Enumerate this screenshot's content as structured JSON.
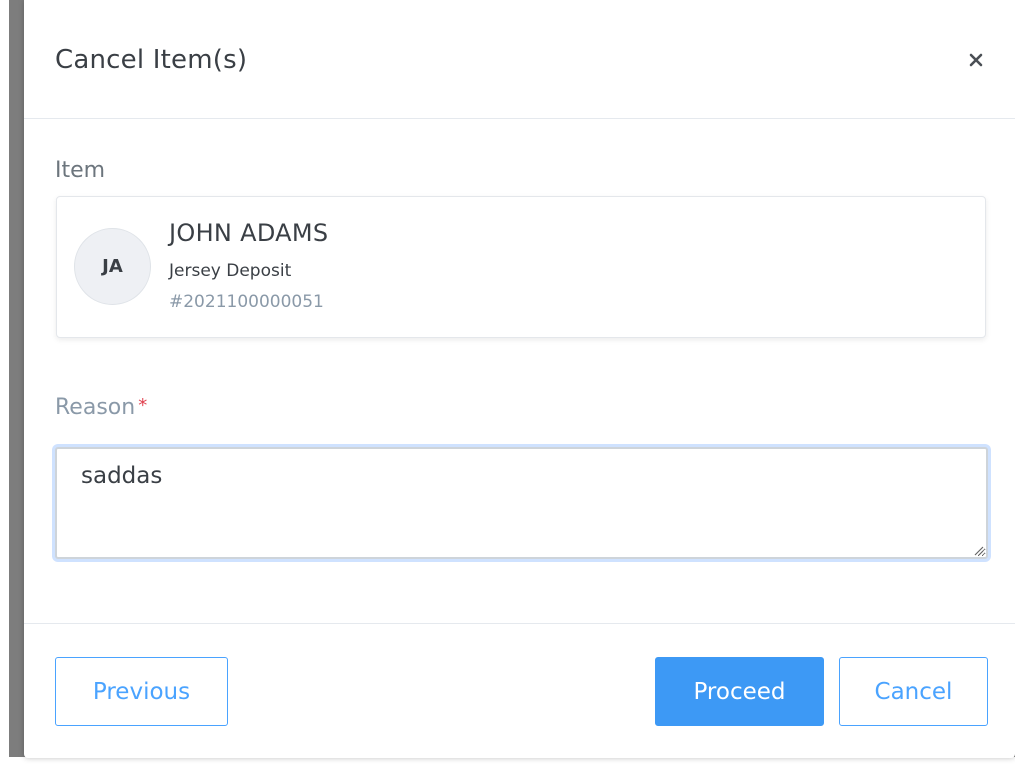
{
  "modal": {
    "title": "Cancel Item(s)",
    "close_icon": "close-icon"
  },
  "item_section": {
    "label": "Item",
    "card": {
      "initials": "JA",
      "name": "JOHN ADAMS",
      "type": "Jersey Deposit",
      "number": "#2021100000051"
    }
  },
  "reason": {
    "label": "Reason",
    "required_marker": "*",
    "value": "saddas"
  },
  "footer": {
    "previous_label": "Previous",
    "proceed_label": "Proceed",
    "cancel_label": "Cancel"
  },
  "colors": {
    "primary": "#3d99f5",
    "required": "#e0414f",
    "muted": "#8a99a8"
  }
}
